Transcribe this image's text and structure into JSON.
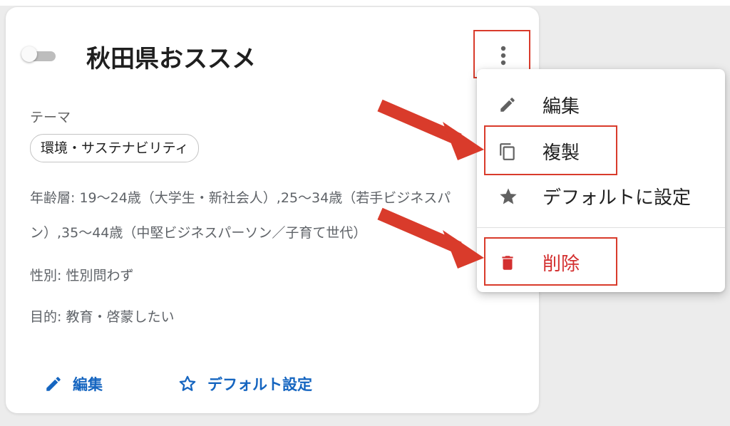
{
  "card": {
    "title": "秋田県おススメ",
    "theme_label": "テーマ",
    "theme_chip": "環境・サステナビリティ",
    "age_line1": "年齢層: 19～24歳（大学生・新社会人）,25～34歳（若手ビジネスパ",
    "age_line2": "ン）,35～44歳（中堅ビジネスパーソン／子育て世代）",
    "gender": "性別: 性別問わず",
    "purpose": "目的: 教育・啓蒙したい",
    "toggle_on": false,
    "footer": {
      "edit_label": "編集",
      "default_label": "デフォルト設定"
    }
  },
  "menu": {
    "items": [
      {
        "label": "編集",
        "icon": "pencil-icon"
      },
      {
        "label": "複製",
        "icon": "copy-icon"
      },
      {
        "label": "デフォルトに設定",
        "icon": "star-icon"
      },
      {
        "label": "削除",
        "icon": "trash-icon"
      }
    ]
  },
  "colors": {
    "accent_blue": "#1565c0",
    "danger_red": "#d32f2f",
    "annotation_red": "#d93b2b"
  }
}
